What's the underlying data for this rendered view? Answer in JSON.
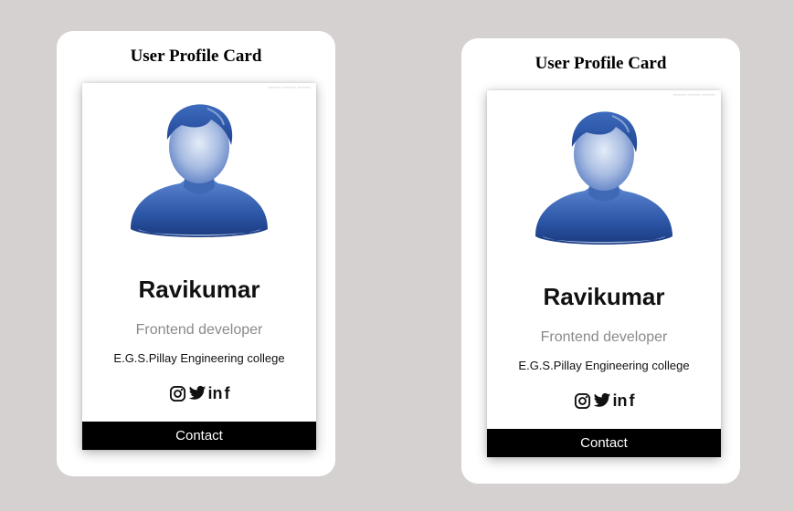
{
  "cards": [
    {
      "title": "User Profile Card",
      "name": "Ravikumar",
      "role": "Frontend developer",
      "college": "E.G.S.Pillay Engineering college",
      "contact_label": "Contact",
      "social_icons": [
        "instagram-icon",
        "twitter-icon",
        "linkedin-icon",
        "facebook-icon"
      ]
    },
    {
      "title": "User Profile Card",
      "name": "Ravikumar",
      "role": "Frontend developer",
      "college": "E.G.S.Pillay Engineering college",
      "contact_label": "Contact",
      "social_icons": [
        "instagram-icon",
        "twitter-icon",
        "linkedin-icon",
        "facebook-icon"
      ]
    }
  ],
  "linkedin_glyph": "in",
  "facebook_glyph": "f",
  "colors": {
    "background": "#d6d1d1",
    "card": "#ffffff",
    "button": "#000000",
    "avatar_blue": "#2e5aa8"
  }
}
